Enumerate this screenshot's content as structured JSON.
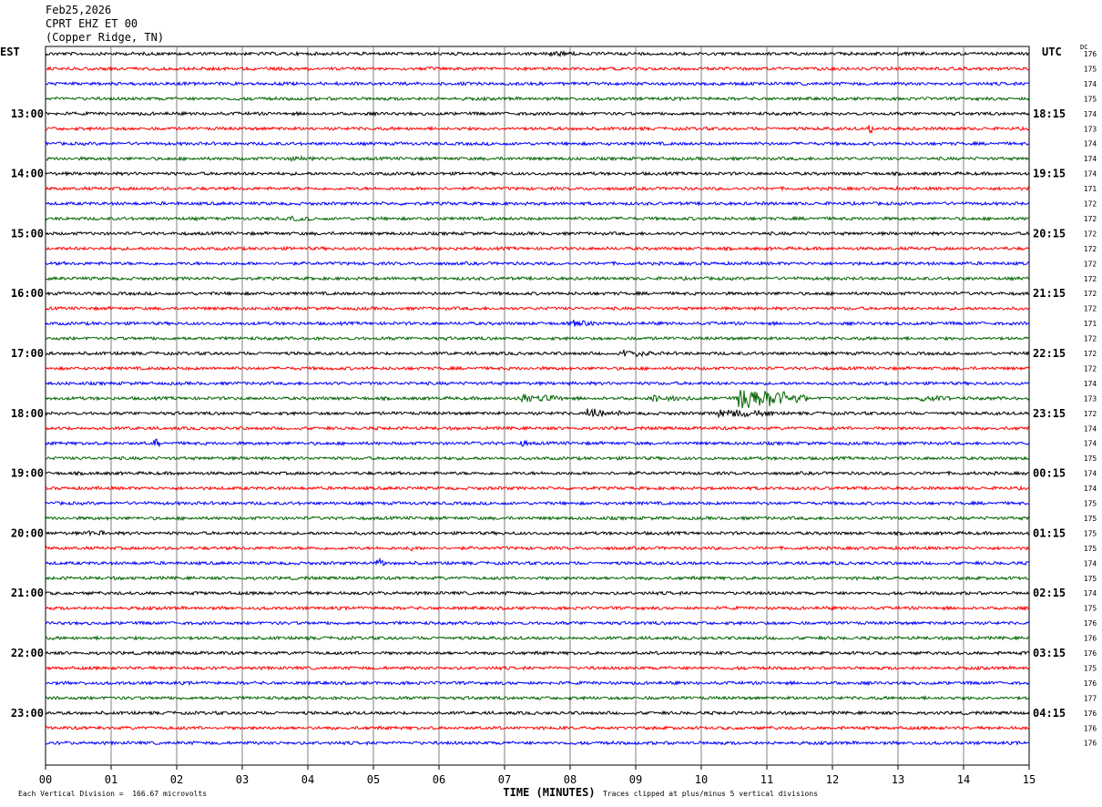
{
  "header": {
    "date": "Feb25,2026",
    "channel": "CPRT EHZ ET 00",
    "location": "(Copper Ridge, TN)"
  },
  "left_zone": "EST",
  "right_zone": "UTC",
  "dc_label": "DC",
  "chart_data": {
    "type": "line",
    "subtype": "helicorder",
    "xlabel": "TIME (MINUTES)",
    "xlim": [
      0,
      15
    ],
    "x_ticks": [
      "00",
      "01",
      "02",
      "03",
      "04",
      "05",
      "06",
      "07",
      "08",
      "09",
      "10",
      "11",
      "12",
      "13",
      "14",
      "15"
    ],
    "grid": true,
    "trace_colors": [
      "#000000",
      "#ff0000",
      "#0000ff",
      "#006400"
    ],
    "left_hour_labels": [
      "13:00",
      "14:00",
      "15:00",
      "16:00",
      "17:00",
      "18:00",
      "19:00",
      "20:00",
      "21:00",
      "22:00",
      "23:00"
    ],
    "right_hour_labels": [
      "18:15",
      "19:15",
      "20:15",
      "21:15",
      "22:15",
      "23:15",
      "00:15",
      "01:15",
      "02:15",
      "03:15",
      "04:15"
    ],
    "label_first_row": 4,
    "label_row_step": 4,
    "dc_offsets": [
      "176",
      "175",
      "174",
      "175",
      "174",
      "173",
      "174",
      "174",
      "174",
      "171",
      "172",
      "172",
      "172",
      "172",
      "172",
      "172",
      "172",
      "172",
      "171",
      "172",
      "172",
      "172",
      "174",
      "173",
      "172",
      "174",
      "174",
      "175",
      "174",
      "174",
      "175",
      "175",
      "175",
      "175",
      "174",
      "175",
      "174",
      "175",
      "176",
      "176",
      "176",
      "175",
      "176",
      "177",
      "176",
      "176",
      "176"
    ],
    "events": [
      {
        "row": 0,
        "t": 7.7,
        "amp": 2.0,
        "dur": 0.4
      },
      {
        "row": 5,
        "t": 12.6,
        "amp": 4.0,
        "dur": 0.05
      },
      {
        "row": 7,
        "t": 3.8,
        "amp": 1.5,
        "dur": 0.3
      },
      {
        "row": 11,
        "t": 3.8,
        "amp": 1.5,
        "dur": 0.3
      },
      {
        "row": 18,
        "t": 8.1,
        "amp": 2.2,
        "dur": 0.3
      },
      {
        "row": 20,
        "t": 8.8,
        "amp": 3.5,
        "dur": 0.5
      },
      {
        "row": 23,
        "t": 7.3,
        "amp": 4.0,
        "dur": 0.6
      },
      {
        "row": 23,
        "t": 9.3,
        "amp": 3.0,
        "dur": 0.6
      },
      {
        "row": 23,
        "t": 10.6,
        "amp": 14.0,
        "dur": 1.0
      },
      {
        "row": 23,
        "t": 13.3,
        "amp": 2.0,
        "dur": 0.6
      },
      {
        "row": 24,
        "t": 8.3,
        "amp": 4.5,
        "dur": 0.5
      },
      {
        "row": 24,
        "t": 10.3,
        "amp": 4.0,
        "dur": 0.8
      },
      {
        "row": 26,
        "t": 1.7,
        "amp": 3.5,
        "dur": 0.05
      },
      {
        "row": 26,
        "t": 7.3,
        "amp": 3.0,
        "dur": 0.05
      },
      {
        "row": 32,
        "t": 0.7,
        "amp": 2.5,
        "dur": 0.2
      },
      {
        "row": 33,
        "t": 5.6,
        "amp": 3.0,
        "dur": 0.03
      },
      {
        "row": 34,
        "t": 5.1,
        "amp": 3.5,
        "dur": 0.1
      }
    ]
  },
  "footer": {
    "scale_note": "Each Vertical Division =  166.67 microvolts",
    "clip_note": "Traces clipped at plus/minus 5 vertical divisions"
  }
}
